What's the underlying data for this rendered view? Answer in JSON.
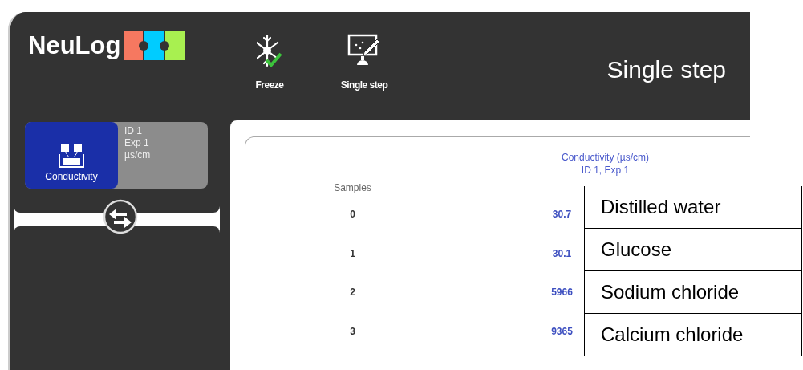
{
  "logo": {
    "text": "NeuLog"
  },
  "toolbar": [
    {
      "label": "Freeze",
      "kind": "freeze"
    },
    {
      "label": "Single step",
      "kind": "step"
    }
  ],
  "mode_title": "Single step",
  "sensor": {
    "name": "Conductivity",
    "lines": [
      "ID 1",
      "Exp 1",
      "µs/cm"
    ]
  },
  "table": {
    "columns": [
      {
        "lines": [
          "Samples"
        ]
      },
      {
        "lines": [
          "Conductivity (µs/cm)",
          "ID 1, Exp 1"
        ]
      }
    ],
    "rows": [
      [
        "0",
        "30.7"
      ],
      [
        "1",
        "30.1"
      ],
      [
        "2",
        "5966"
      ],
      [
        "3",
        "9365"
      ]
    ]
  },
  "annotations": [
    "Distilled water",
    "Glucose",
    "Sodium chloride",
    "Calcium chloride"
  ]
}
